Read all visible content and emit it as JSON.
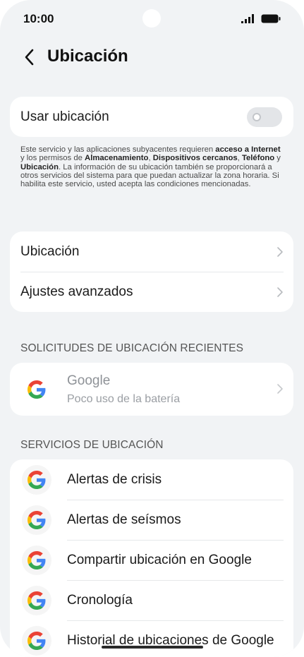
{
  "status_bar": {
    "time": "10:00"
  },
  "header": {
    "title": "Ubicación"
  },
  "toggle_card": {
    "label": "Usar ubicación",
    "state": "off"
  },
  "description": {
    "t1": "Este servicio y las aplicaciones subyacentes requieren ",
    "b1": "acceso a Internet",
    "t2": " y los permisos de ",
    "b2": "Almacenamiento",
    "t3": ", ",
    "b3": "Dispositivos cercanos",
    "t4": ", ",
    "b4": "Teléfono",
    "t5": " y ",
    "b5": "Ubicación",
    "t6": ". La información de su ubicación también se proporcionará a otros servicios del sistema para que puedan actualizar la zona horaria. Si habilita este servicio, usted acepta las condiciones mencionadas."
  },
  "settings_card": {
    "items": [
      {
        "label": "Ubicación"
      },
      {
        "label": "Ajustes avanzados"
      }
    ]
  },
  "recent_requests": {
    "title": "SOLICITUDES DE UBICACIÓN RECIENTES",
    "items": [
      {
        "app": "Google",
        "detail": "Poco uso de la batería",
        "icon": "google-g-icon"
      }
    ]
  },
  "location_services": {
    "title": "SERVICIOS DE UBICACIÓN",
    "items": [
      {
        "label": "Alertas de crisis",
        "icon": "google-g-icon"
      },
      {
        "label": "Alertas de seísmos",
        "icon": "google-g-icon"
      },
      {
        "label": "Compartir ubicación en Google",
        "icon": "google-g-icon"
      },
      {
        "label": "Cronología",
        "icon": "google-g-icon"
      },
      {
        "label": "Historial de ubicaciones de Google",
        "icon": "google-g-icon"
      }
    ]
  },
  "colors": {
    "background": "#f1f3f5",
    "card": "#ffffff",
    "toggle_off": "#e3e5e8",
    "google_blue": "#4285F4",
    "google_red": "#EA4335",
    "google_yellow": "#FBBC05",
    "google_green": "#34A853"
  }
}
